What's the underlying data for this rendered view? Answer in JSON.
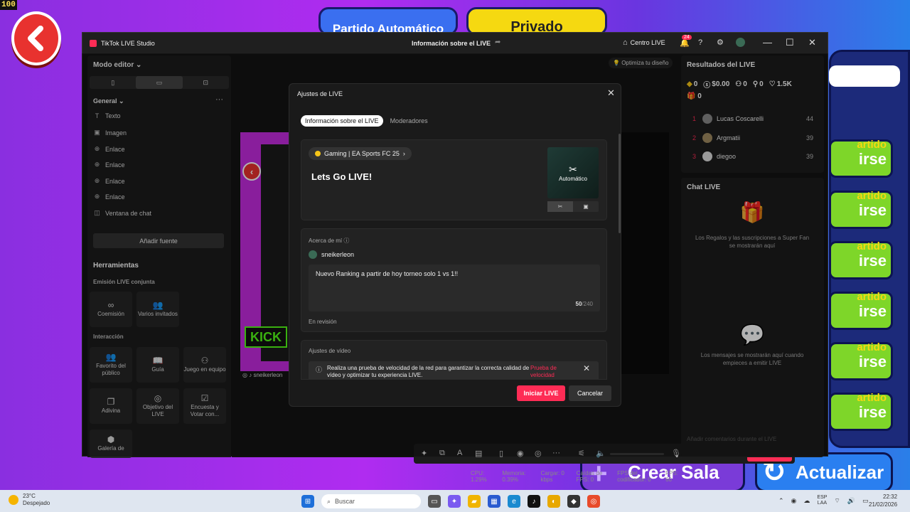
{
  "game": {
    "fps_counter": "100",
    "top_buttons": [
      "Partido Automático",
      "Privado"
    ],
    "side_label_small": "artido",
    "side_label_big": "irse",
    "bottom_buttons": [
      "Crear Sala",
      "Actualizar"
    ]
  },
  "window": {
    "app_title": "TikTok LIVE Studio",
    "center_title": "Información sobre el LIVE",
    "home_label": "Centro LIVE",
    "notif_count": "24"
  },
  "left": {
    "mode_label": "Modo editor",
    "section_label": "General",
    "sources": [
      {
        "icon": "T",
        "label": "Texto"
      },
      {
        "icon": "▣",
        "label": "Imagen"
      },
      {
        "icon": "⊕",
        "label": "Enlace"
      },
      {
        "icon": "⊕",
        "label": "Enlace"
      },
      {
        "icon": "⊕",
        "label": "Enlace"
      },
      {
        "icon": "⊕",
        "label": "Enlace"
      },
      {
        "icon": "◫",
        "label": "Ventana de chat"
      }
    ],
    "add_source": "Añadir fuente",
    "tools_title": "Herramientas",
    "joint_label": "Emisión LIVE conjunta",
    "interaction_label": "Interacción",
    "tools_joint": [
      {
        "label": "Coemisión"
      },
      {
        "label": "Varios invitados"
      }
    ],
    "tools_interaction": [
      {
        "label": "Favorito del público"
      },
      {
        "label": "Guía"
      },
      {
        "label": "Juego en equipo"
      },
      {
        "label": "Adivina"
      },
      {
        "label": "Objetivo del LIVE"
      },
      {
        "label": "Encuesta y Votar con..."
      },
      {
        "label": "Galería de"
      }
    ]
  },
  "preview": {
    "optimize_label": "Optimiza tu diseño",
    "kick_text": "KICK",
    "stream_user": "sneikerleon",
    "start_live": "Iniciar LIVE",
    "stats": [
      "CPU: 1.29%",
      "Memoria: 0.39%",
      "Cargar: 0 kbps",
      "Caídas de FPS: 0",
      "FPS del codificador: 0",
      "FPS: 60"
    ]
  },
  "right": {
    "results_title": "Resultados del LIVE",
    "metrics": [
      "0",
      "$0.00",
      "0",
      "0",
      "1.5K"
    ],
    "gifts": "0",
    "ranking": [
      {
        "rank": "1",
        "name": "Lucas Coscarelli",
        "score": "44"
      },
      {
        "rank": "2",
        "name": "Argmatii",
        "score": "39"
      },
      {
        "rank": "3",
        "name": "diegoo",
        "score": "39"
      }
    ],
    "chat_title": "Chat LIVE",
    "chat_msg1": "Los Regalos y las suscripciones a Super Fan se mostrarán aquí",
    "chat_msg2": "Los mensajes se mostrarán aquí cuando empieces a emitir LIVE",
    "chat_placeholder": "Añadir comentarios durante el LIVE"
  },
  "dialog": {
    "title": "Ajustes de LIVE",
    "tabs": [
      "Información sobre el LIVE",
      "Moderadores"
    ],
    "category": "Gaming | EA Sports FC 25",
    "live_title": "Lets Go LIVE!",
    "thumb_label": "Automático",
    "about_label": "Acerca de mí",
    "username": "sneikerleon",
    "bio": "Nuevo Ranking a partir de hoy torneo solo 1 vs 1!!",
    "bio_count": "50",
    "bio_max": "/240",
    "review_status": "En revisión",
    "video_settings": "Ajustes de vídeo",
    "notice": "Realiza una prueba de velocidad de la red para garantizar la correcta calidad de vídeo y optimizar tu experiencia LIVE.",
    "notice_link": "Prueba de velocidad",
    "start_button": "Iniciar LIVE",
    "cancel_button": "Cancelar"
  },
  "taskbar": {
    "temp": "23°C",
    "weather": "Despejado",
    "search": "Buscar",
    "lang1": "ESP",
    "lang2": "LAA",
    "time": "22:32",
    "date": "21/02/2026"
  }
}
